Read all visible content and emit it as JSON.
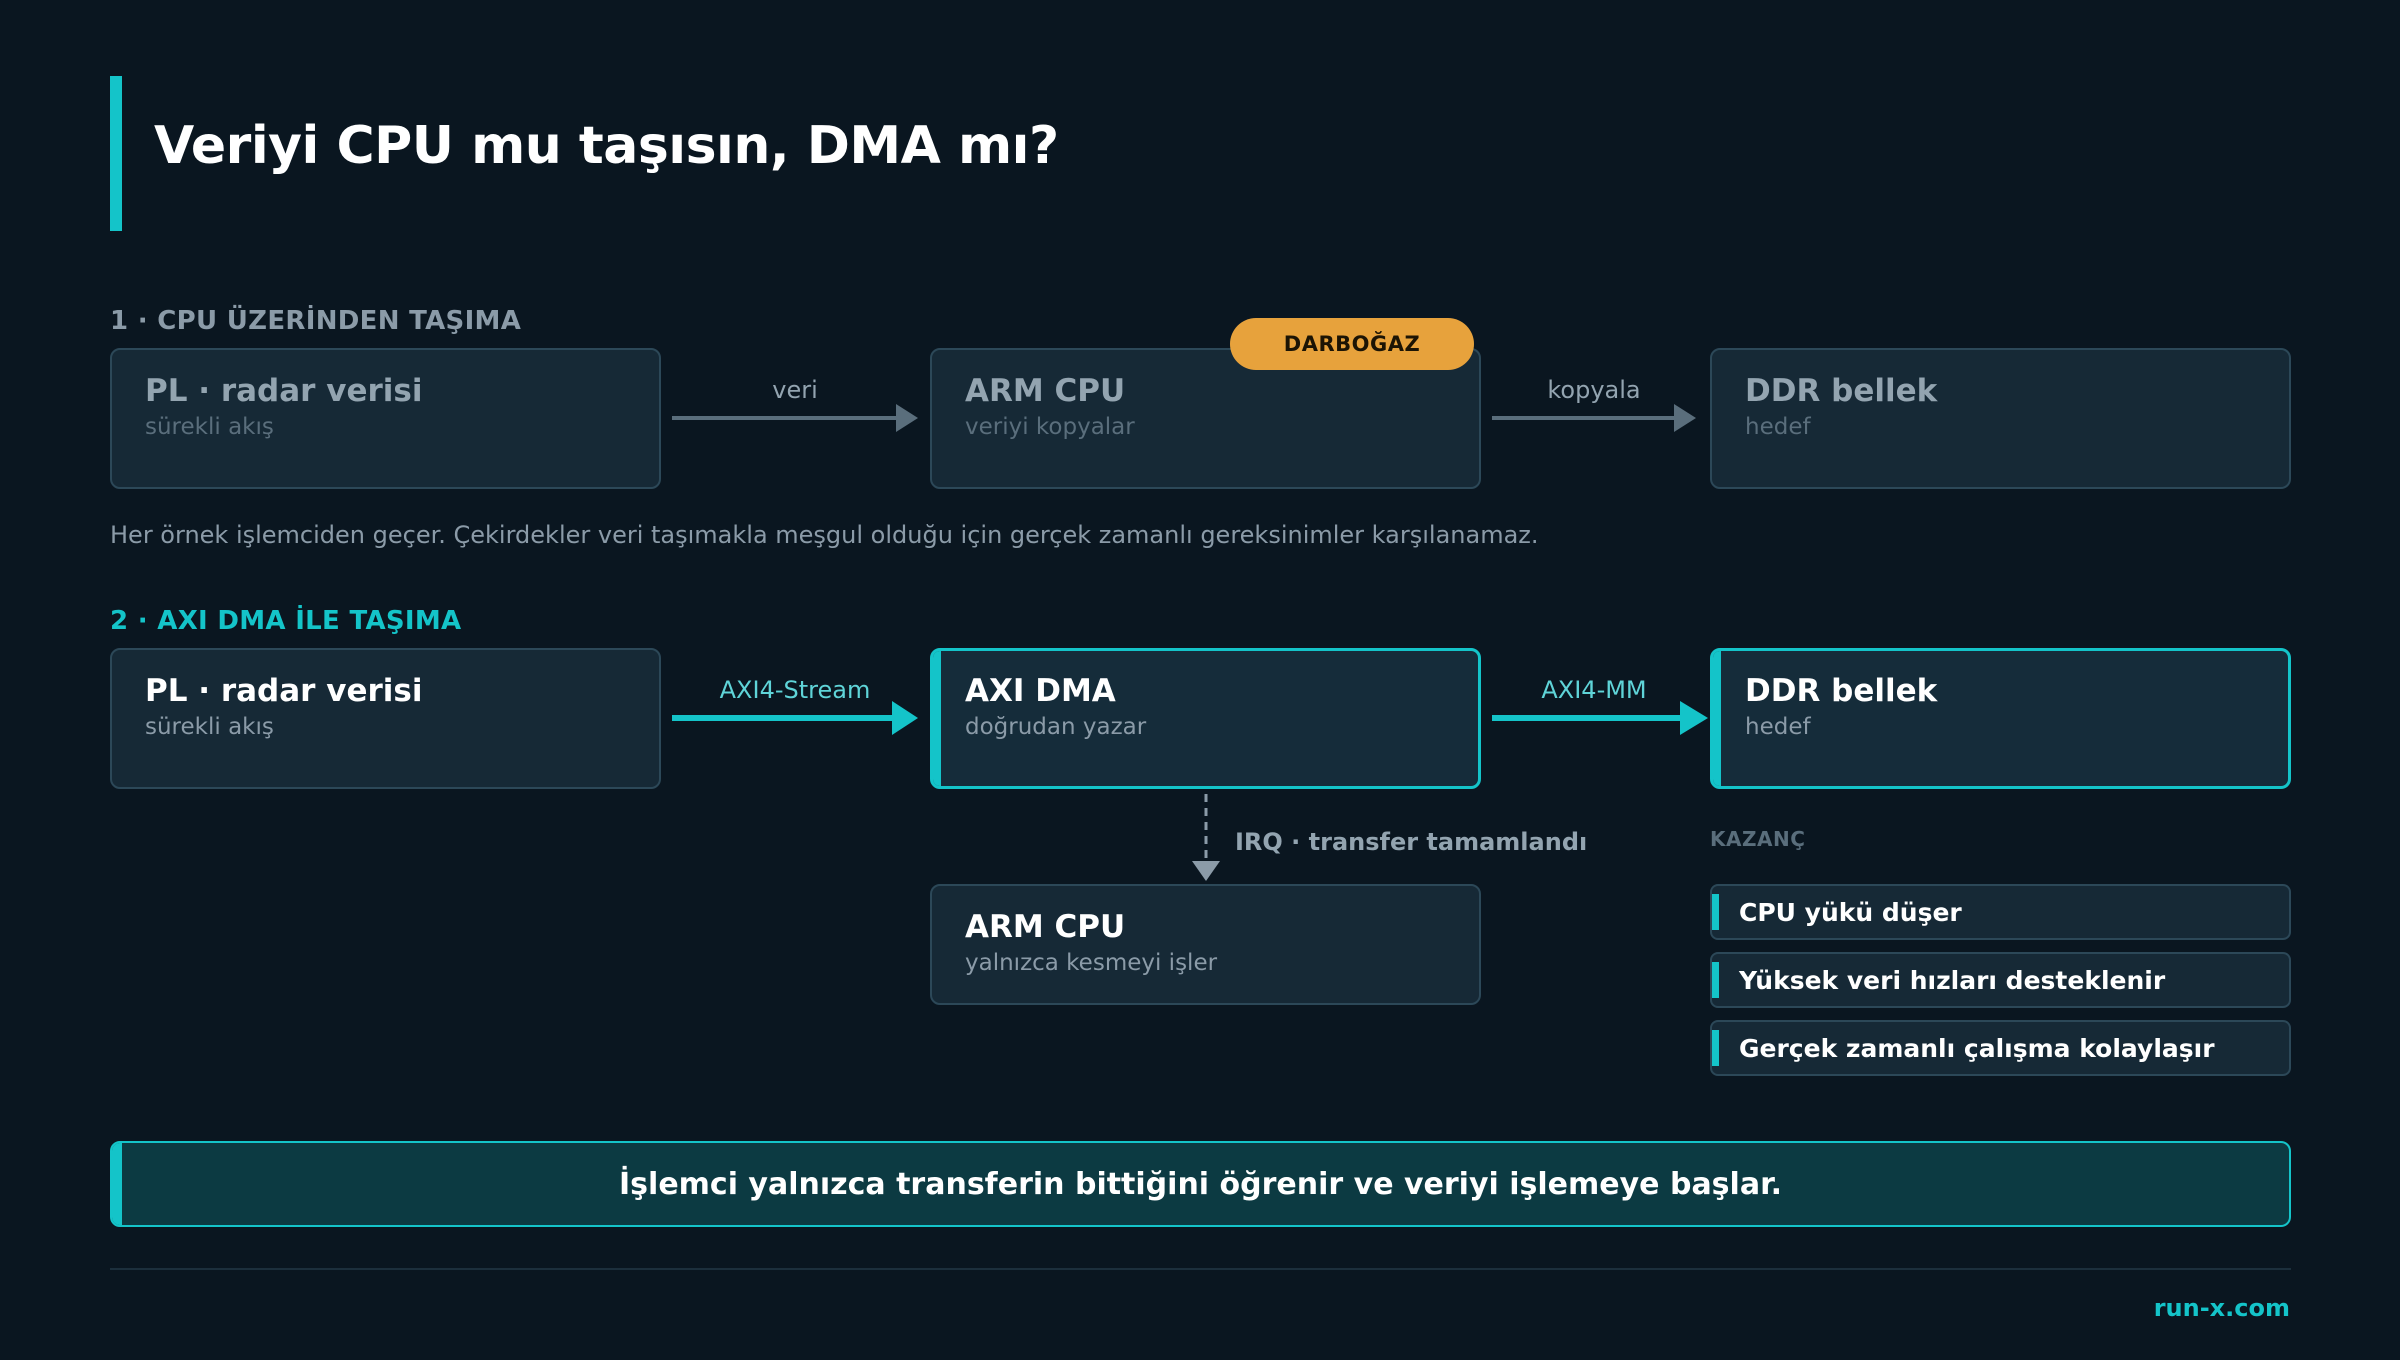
{
  "title": "Veriyi CPU mu taşısın, DMA mı?",
  "section1": {
    "label": "1  ·  CPU ÜZERİNDEN TAŞIMA",
    "boxes": [
      {
        "title": "PL  ·  radar verisi",
        "subtitle": "sürekli akış"
      },
      {
        "title": "ARM CPU",
        "subtitle": "veriyi kopyalar"
      },
      {
        "title": "DDR bellek",
        "subtitle": "hedef"
      }
    ],
    "arrows": [
      "veri",
      "kopyala"
    ],
    "badge": "DARBOĞAZ",
    "note": "Her örnek işlemciden geçer. Çekirdekler veri taşımakla meşgul olduğu için gerçek zamanlı gereksinimler karşılanamaz."
  },
  "section2": {
    "label": "2  ·  AXI DMA İLE TAŞIMA",
    "boxes": [
      {
        "title": "PL  ·  radar verisi",
        "subtitle": "sürekli akış"
      },
      {
        "title": "AXI DMA",
        "subtitle": "doğrudan yazar"
      },
      {
        "title": "DDR bellek",
        "subtitle": "hedef"
      }
    ],
    "arrows": [
      "AXI4-Stream",
      "AXI4-MM"
    ],
    "irq": "IRQ  ·  transfer tamamlandı",
    "cpu": {
      "title": "ARM CPU",
      "subtitle": "yalnızca kesmeyi işler"
    },
    "gains_label": "KAZANÇ",
    "gains": [
      "CPU yükü düşer",
      "Yüksek veri hızları desteklenir",
      "Gerçek zamanlı çalışma kolaylaşır"
    ]
  },
  "banner": "İşlemci yalnızca transferin bittiğini öğrenir ve veriyi işlemeye başlar.",
  "footer": "run-x.com",
  "colors": {
    "background": "#0a1620",
    "accent": "#14c4c9",
    "warning": "#e7a23c",
    "box": "#162936",
    "border": "#2c4858"
  }
}
